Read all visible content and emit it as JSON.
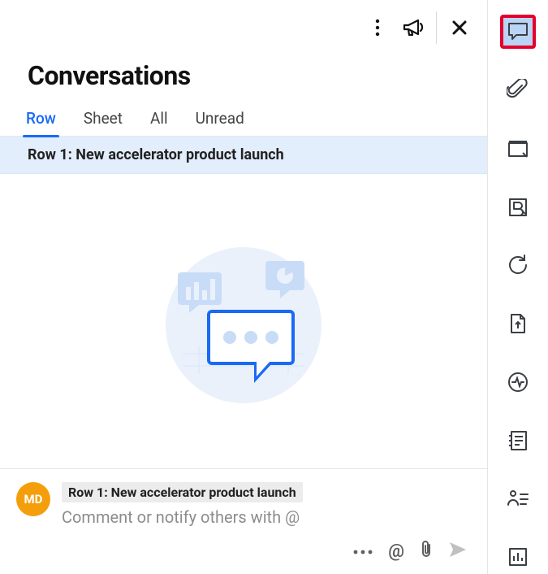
{
  "title": "Conversations",
  "tabs": [
    {
      "label": "Row",
      "active": true
    },
    {
      "label": "Sheet",
      "active": false
    },
    {
      "label": "All",
      "active": false
    },
    {
      "label": "Unread",
      "active": false
    }
  ],
  "row_banner": "Row 1: New accelerator product launch",
  "composer": {
    "avatar_initials": "MD",
    "context_label": "Row 1: New accelerator product launch",
    "placeholder": "Comment or notify others with @"
  },
  "header_icons": {
    "more": "more-vertical-icon",
    "announce": "megaphone-icon",
    "close": "close-icon"
  },
  "composer_tools": {
    "more": "ellipsis-icon",
    "mention": "@",
    "attach": "paperclip-icon",
    "send": "send-icon"
  },
  "rail": [
    {
      "name": "comments-icon",
      "highlighted": true
    },
    {
      "name": "attachments-icon",
      "highlighted": false
    },
    {
      "name": "proofs-icon",
      "highlighted": false
    },
    {
      "name": "brandfolder-icon",
      "highlighted": false
    },
    {
      "name": "refresh-icon",
      "highlighted": false
    },
    {
      "name": "upload-file-icon",
      "highlighted": false
    },
    {
      "name": "activity-icon",
      "highlighted": false
    },
    {
      "name": "summary-icon",
      "highlighted": false
    },
    {
      "name": "people-icon",
      "highlighted": false
    },
    {
      "name": "chart-icon",
      "highlighted": false
    }
  ]
}
